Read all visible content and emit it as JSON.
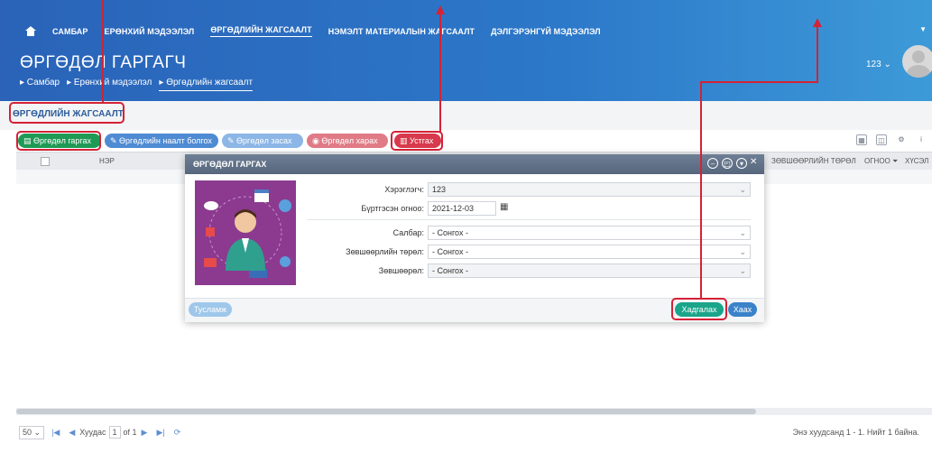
{
  "nav": {
    "items": [
      "САМБАР",
      "ЕРӨНХИЙ МЭДЭЭЛЭЛ",
      "ӨРГӨДЛИЙН ЖАГСААЛТ",
      "НЭМЭЛТ МАТЕРИАЛЫН ЖАГСААЛТ",
      "ДЭЛГЭРЭНГҮЙ МЭДЭЭЛЭЛ"
    ]
  },
  "header": {
    "title": "ӨРГӨДӨЛ ГАРГАГЧ",
    "user": "123 ⌄"
  },
  "breadcrumb": [
    "▸ Самбар",
    "▸ Ерөнхий мэдээлэл",
    "▸ Өргөдлийн жагсаалт"
  ],
  "section": {
    "title": "ӨРГӨДЛИЙН ЖАГСААЛТ"
  },
  "toolbar": {
    "buttons": [
      {
        "label": "Өргөдөл гаргах",
        "color": "#1f9a55"
      },
      {
        "label": "Өргөдлийн наалт болгох",
        "color": "#4f8bd3"
      },
      {
        "label": "Өргөдөл засах",
        "color": "#8cb6e6"
      },
      {
        "label": "Өргөдөл харах",
        "color": "#e07b86"
      },
      {
        "label": "Устгах",
        "color": "#d8394c"
      }
    ]
  },
  "grid": {
    "columns": [
      "НЭР",
      "ЗӨВШӨӨРЛИЙН ТӨРӨЛ",
      "ОГНОО ⏷",
      "ХҮСЭЛ"
    ]
  },
  "pager": {
    "page_size": "50 ⌄",
    "page_label": "Хуудас",
    "page_value": "1",
    "of_label": "of 1",
    "info": "Энэ хуудсанд 1 - 1. Нийт 1 байна."
  },
  "dialog": {
    "title": "ӨРГӨДӨЛ ГАРГАХ",
    "fields": {
      "applicant_label": "Хэрэглэгч:",
      "applicant_value": "123",
      "date_label": "Бүртгэсэн огноо:",
      "date_value": "2021-12-03",
      "branch_label": "Салбар:",
      "branch_value": "- Сонгох -",
      "permit_type_label": "Зөвшөөрлийн төрөл:",
      "permit_type_value": "- Сонгох -",
      "permit_label": "Зөвшөөрөл:",
      "permit_value": "- Сонгох -"
    },
    "help_label": "Тусламж",
    "save_label": "Хадгалах",
    "close_label": "Хаах"
  },
  "colors": {
    "header": "#2c78c9",
    "annotation": "#d42236",
    "save": "#1aa58a",
    "close": "#3a82c9"
  }
}
